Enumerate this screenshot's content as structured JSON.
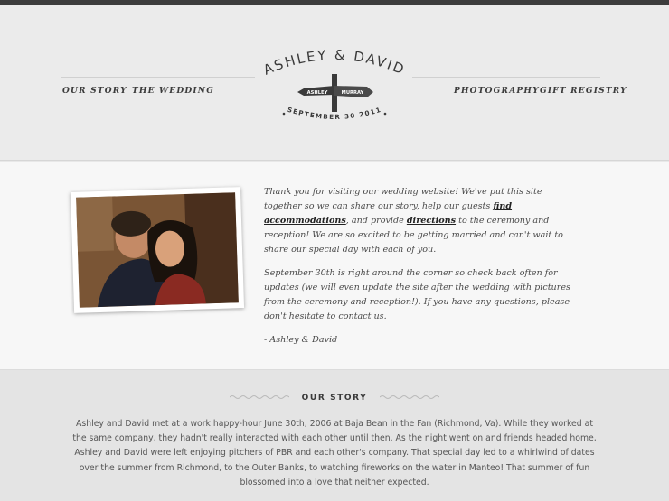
{
  "nav": {
    "left": [
      "OUR STORY",
      "THE WEDDING"
    ],
    "right": [
      "PHOTOGRAPHY",
      "GIFT REGISTRY"
    ]
  },
  "logo": {
    "names": "ASHLEY & DAVID",
    "sign_left": "ASHLEY",
    "sign_right": "MURRAY",
    "date": "SEPTEMBER 30 2011"
  },
  "intro": {
    "p1_a": "Thank you for visiting our wedding website! We've put this site together so we can share our story, help our guests ",
    "p1_link1": "find accommodations",
    "p1_b": ", and provide ",
    "p1_link2": "directions",
    "p1_c": " to the ceremony and reception! We are so excited to be getting married and can't wait to share our special day with each of you.",
    "p2": "September 30th is right around the corner so check back often for updates (we will even update the site after the wedding with pictures from the ceremony and reception!). If you have any questions, please don't hesitate to contact us.",
    "signature": "- Ashley & David"
  },
  "story": {
    "title": "OUR STORY",
    "text": "Ashley and David met at a work happy-hour June 30th, 2006 at Baja Bean in the Fan (Richmond, Va). While they worked at the same company, they hadn't really interacted with each other until then. As the night went on and friends headed home, Ashley and David were left enjoying pitchers of PBR and each other's company. That special day led to a whirlwind of dates over the summer from Richmond, to the Outer Banks, to watching fireworks on the water in Manteo! That summer of fun blossomed into a love that neither expected."
  },
  "colors": {
    "top_bar": "#3d3d3d",
    "header_bg": "#ebebeb",
    "intro_bg": "#f7f7f7",
    "story_bg": "#e4e4e4",
    "text_dark": "#3b3b3b"
  }
}
